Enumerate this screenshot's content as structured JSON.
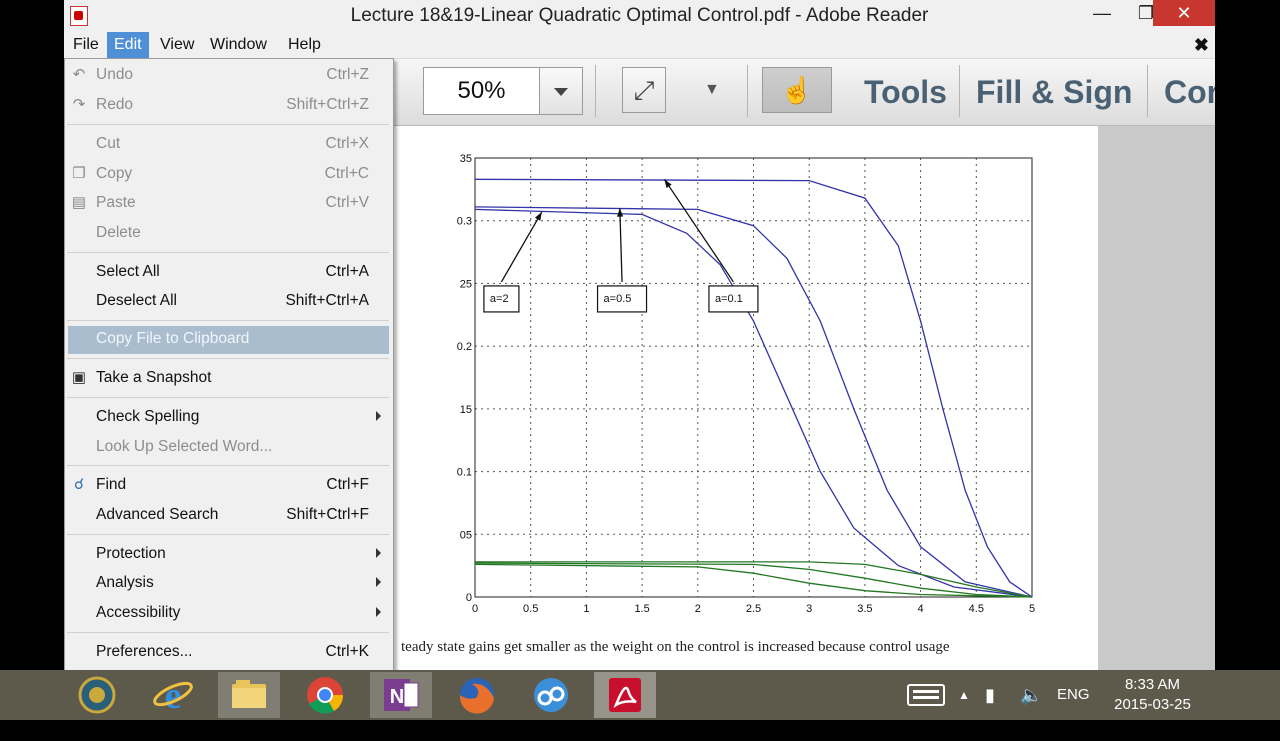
{
  "window": {
    "title": "Lecture 18&19-Linear Quadratic Optimal Control.pdf - Adobe Reader"
  },
  "menubar": {
    "items": [
      "File",
      "Edit",
      "View",
      "Window",
      "Help"
    ],
    "active": "Edit"
  },
  "toolbar": {
    "zoom": "50%",
    "tools_label": "Tools",
    "fill_sign_label": "Fill & Sign",
    "comment_label": "Cor"
  },
  "edit_menu": {
    "undo": {
      "label": "Undo",
      "shortcut": "Ctrl+Z",
      "enabled": false
    },
    "redo": {
      "label": "Redo",
      "shortcut": "Shift+Ctrl+Z",
      "enabled": false
    },
    "cut": {
      "label": "Cut",
      "shortcut": "Ctrl+X",
      "enabled": false
    },
    "copy": {
      "label": "Copy",
      "shortcut": "Ctrl+C",
      "enabled": false
    },
    "paste": {
      "label": "Paste",
      "shortcut": "Ctrl+V",
      "enabled": false
    },
    "delete": {
      "label": "Delete",
      "enabled": false
    },
    "select_all": {
      "label": "Select All",
      "shortcut": "Ctrl+A"
    },
    "deselect_all": {
      "label": "Deselect All",
      "shortcut": "Shift+Ctrl+A"
    },
    "copy_file": {
      "label": "Copy File to Clipboard",
      "highlighted": true
    },
    "snapshot": {
      "label": "Take a Snapshot"
    },
    "spelling": {
      "label": "Check Spelling"
    },
    "lookup": {
      "label": "Look Up Selected Word...",
      "enabled": false
    },
    "find": {
      "label": "Find",
      "shortcut": "Ctrl+F"
    },
    "advanced_search": {
      "label": "Advanced Search",
      "shortcut": "Shift+Ctrl+F"
    },
    "protection": {
      "label": "Protection"
    },
    "analysis": {
      "label": "Analysis"
    },
    "accessibility": {
      "label": "Accessibility"
    },
    "preferences": {
      "label": "Preferences...",
      "shortcut": "Ctrl+K"
    }
  },
  "document": {
    "caption": "teady state gains get smaller as the weight on the control is increased because control usage"
  },
  "chart_data": {
    "type": "line",
    "x_ticks": [
      0,
      0.5,
      1,
      1.5,
      2,
      2.5,
      3,
      3.5,
      4,
      4.5,
      5
    ],
    "x_tick_labels": [
      "0",
      "0.5",
      "1",
      "1.5",
      "2",
      "2.5",
      "3",
      "3.5",
      "4",
      "4.5",
      "5"
    ],
    "y_tick_labels": [
      {
        "v": 0,
        "t": "0"
      },
      {
        "v": 0.05,
        "t": "05"
      },
      {
        "v": 0.1,
        "t": "0.1"
      },
      {
        "v": 0.15,
        "t": "15"
      },
      {
        "v": 0.2,
        "t": "0.2"
      },
      {
        "v": 0.25,
        "t": "25"
      },
      {
        "v": 0.3,
        "t": "0.3"
      },
      {
        "v": 0.35,
        "t": "35"
      }
    ],
    "xlim": [
      0,
      5
    ],
    "ylim": [
      0,
      0.35
    ],
    "grid": true,
    "series": [
      {
        "color": "#3333aa",
        "values": [
          [
            0,
            0.333
          ],
          [
            3.0,
            0.332
          ],
          [
            3.5,
            0.318
          ],
          [
            3.8,
            0.28
          ],
          [
            4.0,
            0.22
          ],
          [
            4.2,
            0.15
          ],
          [
            4.4,
            0.085
          ],
          [
            4.6,
            0.04
          ],
          [
            4.8,
            0.012
          ],
          [
            5,
            0
          ]
        ]
      },
      {
        "color": "#3333aa",
        "values": [
          [
            0,
            0.311
          ],
          [
            2.0,
            0.309
          ],
          [
            2.5,
            0.296
          ],
          [
            2.8,
            0.27
          ],
          [
            3.1,
            0.22
          ],
          [
            3.4,
            0.15
          ],
          [
            3.7,
            0.085
          ],
          [
            4.0,
            0.04
          ],
          [
            4.4,
            0.012
          ],
          [
            5,
            0
          ]
        ]
      },
      {
        "color": "#3333aa",
        "values": [
          [
            0,
            0.309
          ],
          [
            1.5,
            0.305
          ],
          [
            1.9,
            0.29
          ],
          [
            2.2,
            0.265
          ],
          [
            2.5,
            0.22
          ],
          [
            2.8,
            0.16
          ],
          [
            3.1,
            0.1
          ],
          [
            3.4,
            0.055
          ],
          [
            3.8,
            0.025
          ],
          [
            4.3,
            0.008
          ],
          [
            5,
            0
          ]
        ]
      },
      {
        "color": "#227722",
        "values": [
          [
            0,
            0.028
          ],
          [
            3.0,
            0.028
          ],
          [
            3.5,
            0.026
          ],
          [
            4.0,
            0.018
          ],
          [
            4.5,
            0.008
          ],
          [
            5,
            0
          ]
        ]
      },
      {
        "color": "#227722",
        "values": [
          [
            0,
            0.027
          ],
          [
            2.5,
            0.026
          ],
          [
            3.0,
            0.022
          ],
          [
            3.5,
            0.015
          ],
          [
            4.0,
            0.007
          ],
          [
            4.5,
            0.002
          ],
          [
            5,
            0
          ]
        ]
      },
      {
        "color": "#227722",
        "values": [
          [
            0,
            0.026
          ],
          [
            2.0,
            0.024
          ],
          [
            2.5,
            0.019
          ],
          [
            3.0,
            0.011
          ],
          [
            3.5,
            0.005
          ],
          [
            4.0,
            0.002
          ],
          [
            5,
            0
          ]
        ]
      }
    ],
    "annotations": [
      {
        "text": "a=2",
        "box": [
          0.08,
          0.248
        ],
        "arrow_to": [
          0.6,
          0.307
        ]
      },
      {
        "text": "a=0.5",
        "box": [
          1.1,
          0.248
        ],
        "arrow_to": [
          1.3,
          0.31
        ]
      },
      {
        "text": "a=0.1",
        "box": [
          2.1,
          0.248
        ],
        "arrow_to": [
          1.7,
          0.333
        ]
      }
    ]
  },
  "taskbar": {
    "apps": [
      "Shell",
      "Internet Explorer",
      "File Explorer",
      "Chrome",
      "OneNote",
      "Firefox",
      "Cloud",
      "Adobe Reader"
    ],
    "language": "ENG",
    "time": "8:33 AM",
    "date": "2015-03-25"
  }
}
